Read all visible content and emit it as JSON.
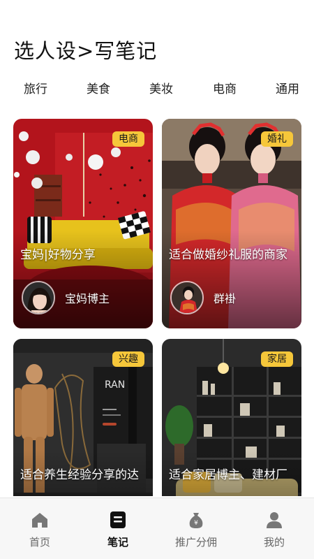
{
  "page": {
    "title": "选人设>写笔记"
  },
  "categories": [
    "旅行",
    "美食",
    "美妆",
    "电商",
    "通用"
  ],
  "cards": [
    {
      "badge": "电商",
      "title": "宝妈|好物分享",
      "author": "宝妈博主"
    },
    {
      "badge": "婚礼",
      "title": "适合做婚纱礼服的商家",
      "author": "群褂"
    },
    {
      "badge": "兴趣",
      "title": "适合养生经验分享的达",
      "author": ""
    },
    {
      "badge": "家居",
      "title": "适合家居博主、建材厂",
      "author": ""
    }
  ],
  "card3_poster_text": "RAN",
  "tabbar": {
    "items": [
      {
        "label": "首页",
        "icon": "home-icon"
      },
      {
        "label": "笔记",
        "icon": "notes-icon"
      },
      {
        "label": "推广分佣",
        "icon": "money-bag-icon"
      },
      {
        "label": "我的",
        "icon": "user-icon"
      }
    ],
    "active_index": 1
  },
  "colors": {
    "badge": "#f6c73a",
    "active_tab": "#111111",
    "inactive_tab": "#666666"
  }
}
